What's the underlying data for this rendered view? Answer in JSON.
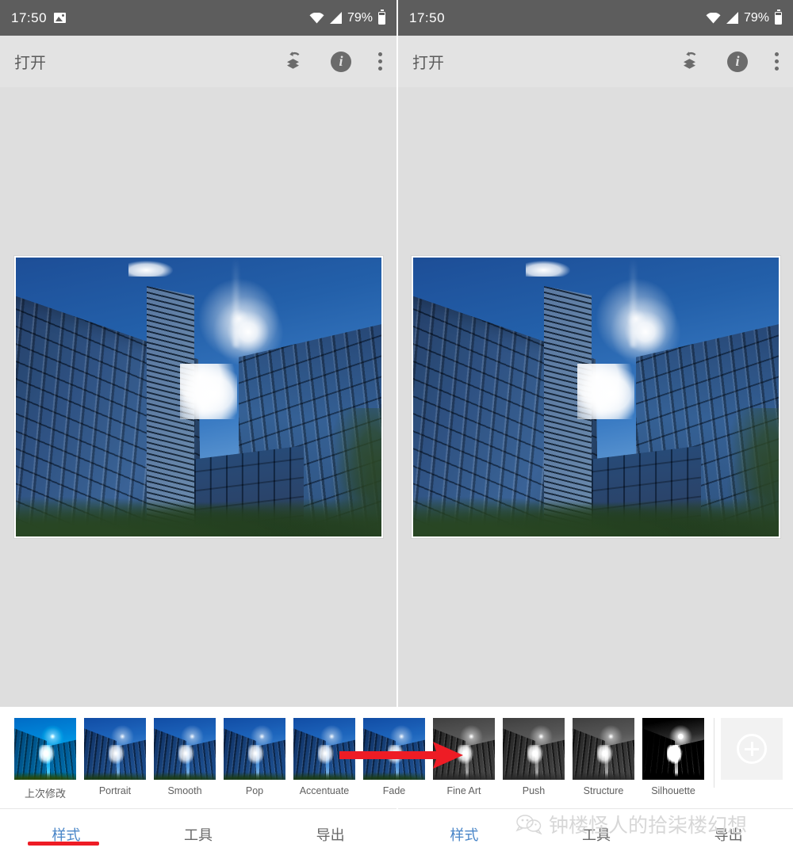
{
  "app": {
    "title_bar_label": "打开",
    "accent_color": "#4a86c8",
    "annotation_color": "#ee1c25",
    "canvas_bg": "#dedede",
    "statusbar_bg": "#5d5d5d"
  },
  "statusbar": {
    "time": "17:50",
    "battery_percent": "79%",
    "icons_left": [
      "photo-icon"
    ],
    "icons_right": [
      "wifi-icon",
      "cell-signal-icon",
      "battery-icon"
    ]
  },
  "appbar": {
    "title": "打开",
    "actions": [
      {
        "name": "undo-stack-icon",
        "label": "撤销"
      },
      {
        "name": "info-icon",
        "label": "i"
      },
      {
        "name": "overflow-menu-icon",
        "label": "⋮"
      }
    ]
  },
  "photo": {
    "description": "glass office towers shot upward against blue sky with sun flare"
  },
  "presets": [
    {
      "label": "上次修改",
      "tone": "teal",
      "cn": true
    },
    {
      "label": "Portrait",
      "tone": "blue",
      "cn": false
    },
    {
      "label": "Smooth",
      "tone": "blue",
      "cn": false
    },
    {
      "label": "Pop",
      "tone": "blue",
      "cn": false
    },
    {
      "label": "Accentuate",
      "tone": "blue",
      "cn": false
    },
    {
      "label": "Fade",
      "tone": "blue",
      "cn": false
    },
    {
      "label": "Fine Art",
      "tone": "gray",
      "cn": false
    },
    {
      "label": "Push",
      "tone": "gray",
      "cn": false
    },
    {
      "label": "Structure",
      "tone": "gray",
      "cn": false
    },
    {
      "label": "Silhouette",
      "tone": "gray-high",
      "cn": false
    }
  ],
  "add_preset": {
    "name": "add-preset-button",
    "icon": "plus-circle-icon"
  },
  "tabs_left": [
    {
      "label": "样式",
      "active": true
    },
    {
      "label": "工具",
      "active": false
    },
    {
      "label": "导出",
      "active": false
    }
  ],
  "tabs_right": [
    {
      "label": "样式",
      "active": true
    },
    {
      "label": "工具",
      "active": false
    },
    {
      "label": "导出",
      "active": false
    }
  ],
  "annotations": {
    "arrow": {
      "name": "red-arrow-annotation",
      "direction": "right"
    },
    "underline": {
      "name": "red-underline-annotation",
      "target": "样式"
    }
  },
  "watermark": {
    "text": "钟楼怪人的拾柒楼幻想",
    "icon": "wechat-icon"
  }
}
